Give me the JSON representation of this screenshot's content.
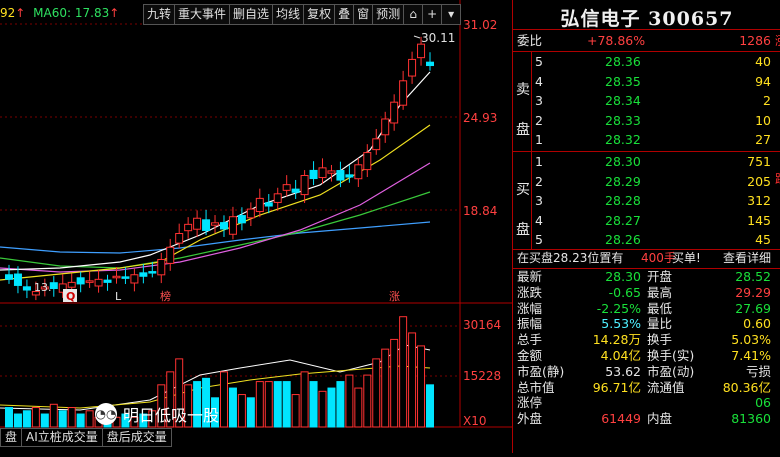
{
  "ma_legend": {
    "prefix": "92",
    "arrow1": "↑",
    "ma60_label": "MA60: 17.83",
    "arrow2": "↑"
  },
  "toolbar": [
    "九转",
    "重大事件",
    "删自选",
    "均线",
    "复权",
    "叠",
    "窗",
    "预测"
  ],
  "toolbar_icons": [
    "home-icon",
    "plus-icon",
    "dropdown-icon"
  ],
  "price_axis": {
    "top": "31.02",
    "mid1": "24.93",
    "mid2": "18.84"
  },
  "volume_axis": {
    "top": "30164",
    "mid": "15228",
    "unit": "X10"
  },
  "annotations": {
    "high": "30.11",
    "low": "13.",
    "mark_q": "Q",
    "mark_l": "L",
    "mark_bang": "榜",
    "mark_zhang": "涨"
  },
  "bottom_tabs": [
    "盘",
    "AI立桩成交量",
    "盘后成交量"
  ],
  "colors": {
    "up": "#ff3232",
    "down": "#00e5ff",
    "grid": "#7a0000",
    "bg": "#000000"
  },
  "stock": {
    "name": "弘信电子",
    "code": "300657"
  },
  "weibi": {
    "label": "委比",
    "percent": "+78.86%",
    "diff": "1286"
  },
  "sell_side": {
    "label": "卖盘",
    "rows": [
      {
        "level": "5",
        "price": "28.36",
        "vol": "40"
      },
      {
        "level": "4",
        "price": "28.35",
        "vol": "94"
      },
      {
        "level": "3",
        "price": "28.34",
        "vol": "2"
      },
      {
        "level": "2",
        "price": "28.33",
        "vol": "10"
      },
      {
        "level": "1",
        "price": "28.32",
        "vol": "27"
      }
    ]
  },
  "buy_side": {
    "label": "买盘",
    "rows": [
      {
        "level": "1",
        "price": "28.30",
        "vol": "751"
      },
      {
        "level": "2",
        "price": "28.29",
        "vol": "205"
      },
      {
        "level": "3",
        "price": "28.28",
        "vol": "312"
      },
      {
        "level": "4",
        "price": "28.27",
        "vol": "145"
      },
      {
        "level": "5",
        "price": "28.26",
        "vol": "45"
      }
    ]
  },
  "order_note": {
    "text": "在买盘28.23位置有",
    "amount": "400手",
    "action": "买单!",
    "link": "查看详细"
  },
  "quote": [
    {
      "l1": "最新",
      "v1": "28.30",
      "c1": "green",
      "l2": "开盘",
      "v2": "28.52",
      "c2": "green"
    },
    {
      "l1": "涨跌",
      "v1": "-0.65",
      "c1": "green",
      "l2": "最高",
      "v2": "29.29",
      "c2": "red"
    },
    {
      "l1": "涨幅",
      "v1": "-2.25%",
      "c1": "green",
      "l2": "最低",
      "v2": "27.69",
      "c2": "green"
    },
    {
      "l1": "振幅",
      "v1": "5.53%",
      "c1": "cyan",
      "l2": "量比",
      "v2": "0.60",
      "c2": "yellow"
    },
    {
      "l1": "总手",
      "v1": "14.28万",
      "c1": "yellow",
      "l2": "换手",
      "v2": "5.03%",
      "c2": "yellow"
    },
    {
      "l1": "金额",
      "v1": "4.04亿",
      "c1": "yellow",
      "l2": "换手(实)",
      "v2": "7.41%",
      "c2": "yellow"
    },
    {
      "l1": "市盈(静)",
      "v1": "53.62",
      "c1": "wht",
      "l2": "市盈(动)",
      "v2": "亏损",
      "c2": "wht"
    },
    {
      "l1": "总市值",
      "v1": "96.71亿",
      "c1": "yellow",
      "l2": "流通值",
      "v2": "80.36亿",
      "c2": "yellow"
    },
    {
      "l1": "涨停",
      "v1": "",
      "c1": "red",
      "l2": "",
      "v2": "06",
      "c2": "green"
    },
    {
      "l1": "外盘",
      "v1": "61449",
      "c1": "red",
      "l2": "内盘",
      "v2": "81360",
      "c2": "green"
    }
  ],
  "watermark": {
    "text": "明日低吸一股"
  },
  "edge_text": {
    "a": "涨",
    "b": "跌"
  }
}
